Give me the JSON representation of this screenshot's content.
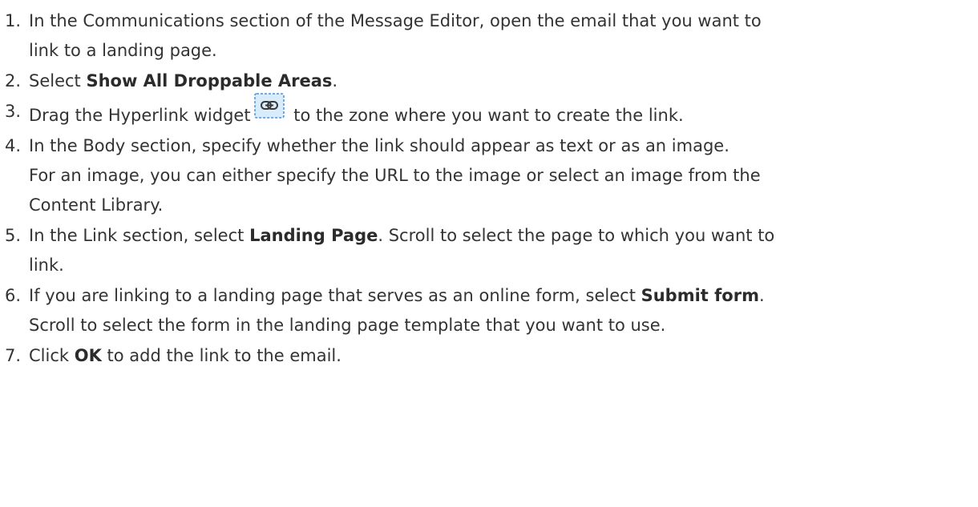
{
  "steps": [
    {
      "number": "1.",
      "lines": [
        "In the Communications section of the Message Editor, open the email that you want to",
        "link to a landing page."
      ]
    },
    {
      "number": "2.",
      "before": "Select ",
      "bold": "Show All Droppable Areas",
      "after": "."
    },
    {
      "number": "3.",
      "before": "Drag the Hyperlink widget",
      "icon": "hyperlink-widget-icon",
      "after": " to the zone where you want to create the link."
    },
    {
      "number": "4.",
      "lines": [
        "In the Body section, specify whether the link should appear as text or as an image.",
        "For an image, you can either specify the URL to the image or select an image from the",
        "Content Library."
      ]
    },
    {
      "number": "5.",
      "before": "In the Link section, select ",
      "bold": "Landing Page",
      "after": ". Scroll to select the page to which you want to",
      "line2": "link."
    },
    {
      "number": "6.",
      "before": "If you are linking to a landing page that serves as an online form, select ",
      "bold": "Submit form",
      "after": ".",
      "line2": "Scroll to select the form in the landing page template that you want to use."
    },
    {
      "number": "7.",
      "before": "Click ",
      "bold": "OK",
      "after": " to add the link to the email."
    }
  ],
  "colors": {
    "text": "#333333",
    "icon_fill": "#d9ecfb",
    "icon_border": "#4a90d9"
  }
}
